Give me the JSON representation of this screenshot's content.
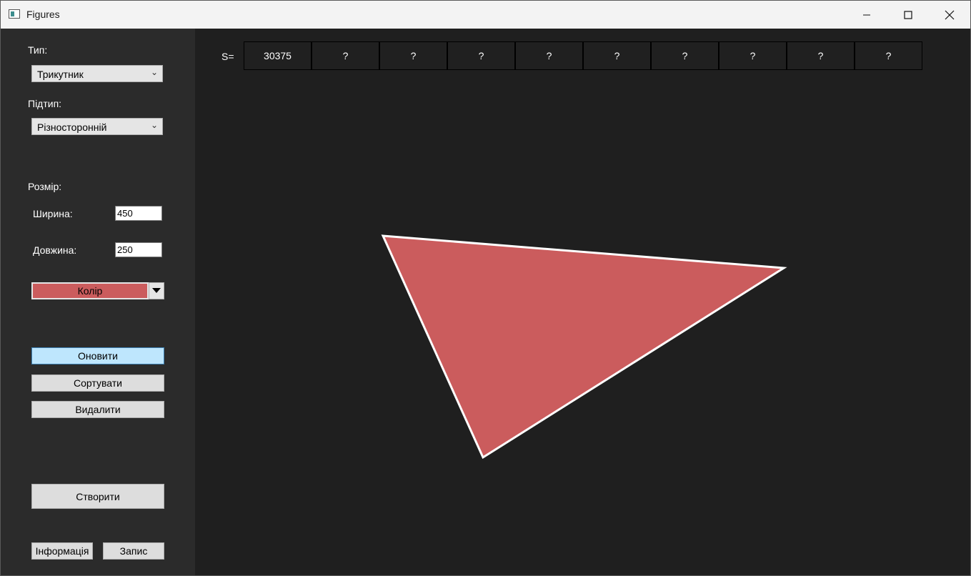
{
  "window": {
    "title": "Figures"
  },
  "sidebar": {
    "type_label": "Тип:",
    "type_value": "Трикутник",
    "subtype_label": "Підтип:",
    "subtype_value": "Різносторонній",
    "size_label": "Розмір:",
    "width_label": "Ширина:",
    "width_value": "450",
    "length_label": "Довжина:",
    "length_value": "250",
    "color_label": "Колір",
    "color_value": "#cb5c5d",
    "refresh_label": "Оновити",
    "sort_label": "Сортувати",
    "delete_label": "Видалити",
    "create_label": "Створити",
    "info_label": "Інформація",
    "save_label": "Запис"
  },
  "areas": {
    "label": "S=",
    "cells": [
      "30375",
      "?",
      "?",
      "?",
      "?",
      "?",
      "?",
      "?",
      "?",
      "?"
    ]
  },
  "figure": {
    "shape": "triangle",
    "fill": "#cb5c5d",
    "stroke": "#ffffff"
  },
  "icons": {
    "app": "window-app-icon",
    "minimize": "minimize-icon",
    "maximize": "maximize-icon",
    "close": "close-icon",
    "dropdown": "chevron-down-icon"
  }
}
